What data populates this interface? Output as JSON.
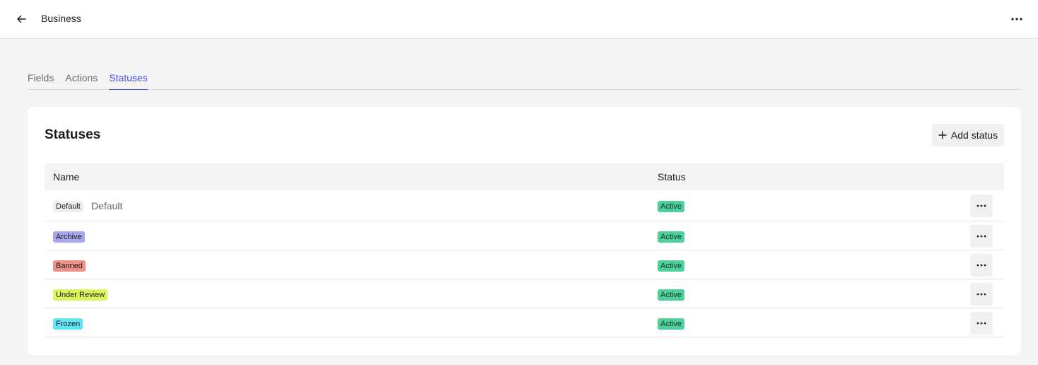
{
  "header": {
    "title": "Business",
    "back_icon": "arrow-left-icon",
    "more_icon": "more-horizontal-icon"
  },
  "tabs": [
    {
      "label": "Fields",
      "active": false
    },
    {
      "label": "Actions",
      "active": false
    },
    {
      "label": "Statuses",
      "active": true
    }
  ],
  "card": {
    "title": "Statuses",
    "add_button_label": "Add status"
  },
  "table": {
    "columns": [
      "Name",
      "Status"
    ],
    "rows": [
      {
        "name": "Default",
        "description": "Default",
        "color": "#efefef",
        "status": "Active"
      },
      {
        "name": "Archive",
        "description": "",
        "color": "#a8a6ee",
        "status": "Active"
      },
      {
        "name": "Banned",
        "description": "",
        "color": "#f08f86",
        "status": "Active"
      },
      {
        "name": "Under Review",
        "description": "",
        "color": "#dcf55a",
        "status": "Active"
      },
      {
        "name": "Frozen",
        "description": "",
        "color": "#5fe6f2",
        "status": "Active"
      }
    ]
  },
  "colors": {
    "accent": "#4a4ee8",
    "active_badge": "#4fd09a"
  }
}
